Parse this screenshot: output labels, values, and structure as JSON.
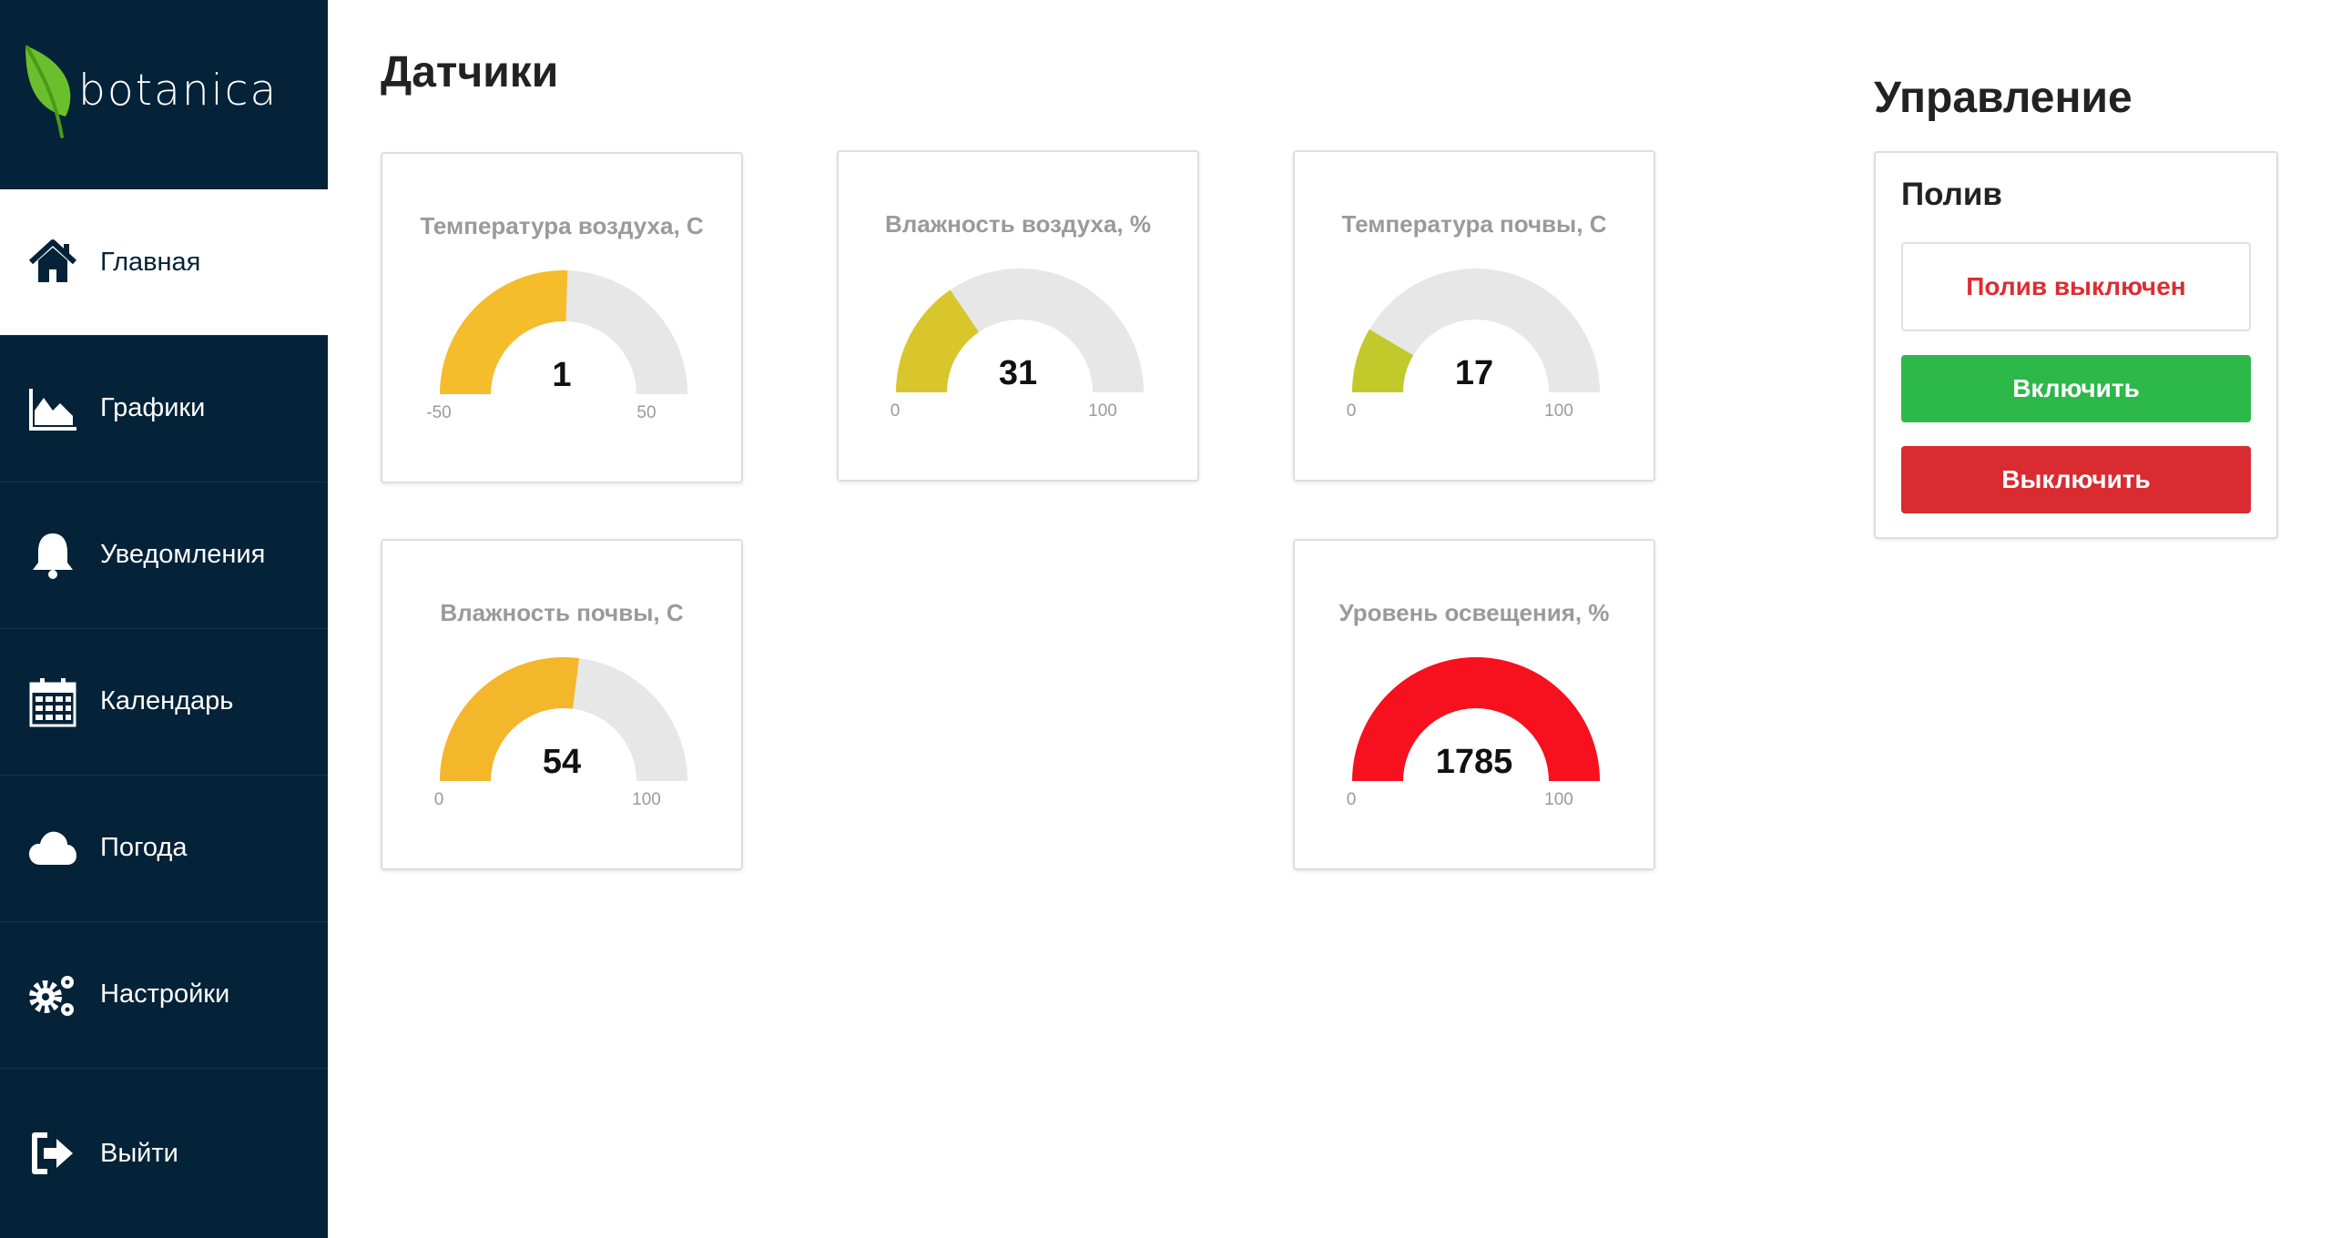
{
  "app": {
    "logo_text": "botanica"
  },
  "sidebar": {
    "items": [
      {
        "label": "Главная",
        "icon": "home-icon",
        "active": true
      },
      {
        "label": "Графики",
        "icon": "area-chart-icon"
      },
      {
        "label": "Уведомления",
        "icon": "bell-icon"
      },
      {
        "label": "Календарь",
        "icon": "calendar-icon"
      },
      {
        "label": "Погода",
        "icon": "cloud-icon"
      },
      {
        "label": "Настройки",
        "icon": "gears-icon"
      },
      {
        "label": "Выйти",
        "icon": "sign-out-icon"
      }
    ]
  },
  "sensors": {
    "title": "Датчики",
    "gauges": [
      {
        "title": "Температура воздуха, С",
        "value": "1",
        "min": "-50",
        "max": "50",
        "numeric": 1,
        "lo": -50,
        "hi": 50,
        "color": "#f5bc2c"
      },
      {
        "title": "Влажность воздуха, %",
        "value": "31",
        "min": "0",
        "max": "100",
        "numeric": 31,
        "lo": 0,
        "hi": 100,
        "color": "#d9c62c"
      },
      {
        "title": "Температура почвы, С",
        "value": "17",
        "min": "0",
        "max": "100",
        "numeric": 17,
        "lo": 0,
        "hi": 100,
        "color": "#c2c92a"
      },
      {
        "title": "Влажность почвы, С",
        "value": "54",
        "min": "0",
        "max": "100",
        "numeric": 54,
        "lo": 0,
        "hi": 100,
        "color": "#f4b62a"
      },
      {
        "title": "Уровень освещения, %",
        "value": "1785",
        "min": "0",
        "max": "100",
        "numeric": 1785,
        "lo": 0,
        "hi": 100,
        "color": "#f7101e"
      }
    ]
  },
  "control": {
    "title": "Управление",
    "watering": {
      "subtitle": "Полив",
      "status": "Полив выключен",
      "on_label": "Включить",
      "off_label": "Выключить"
    }
  },
  "colors": {
    "sidebar_bg": "#042238",
    "track": "#e7e7e7",
    "status_text": "#dc2d32",
    "on_button": "#2db84a",
    "off_button": "#d92b30"
  }
}
